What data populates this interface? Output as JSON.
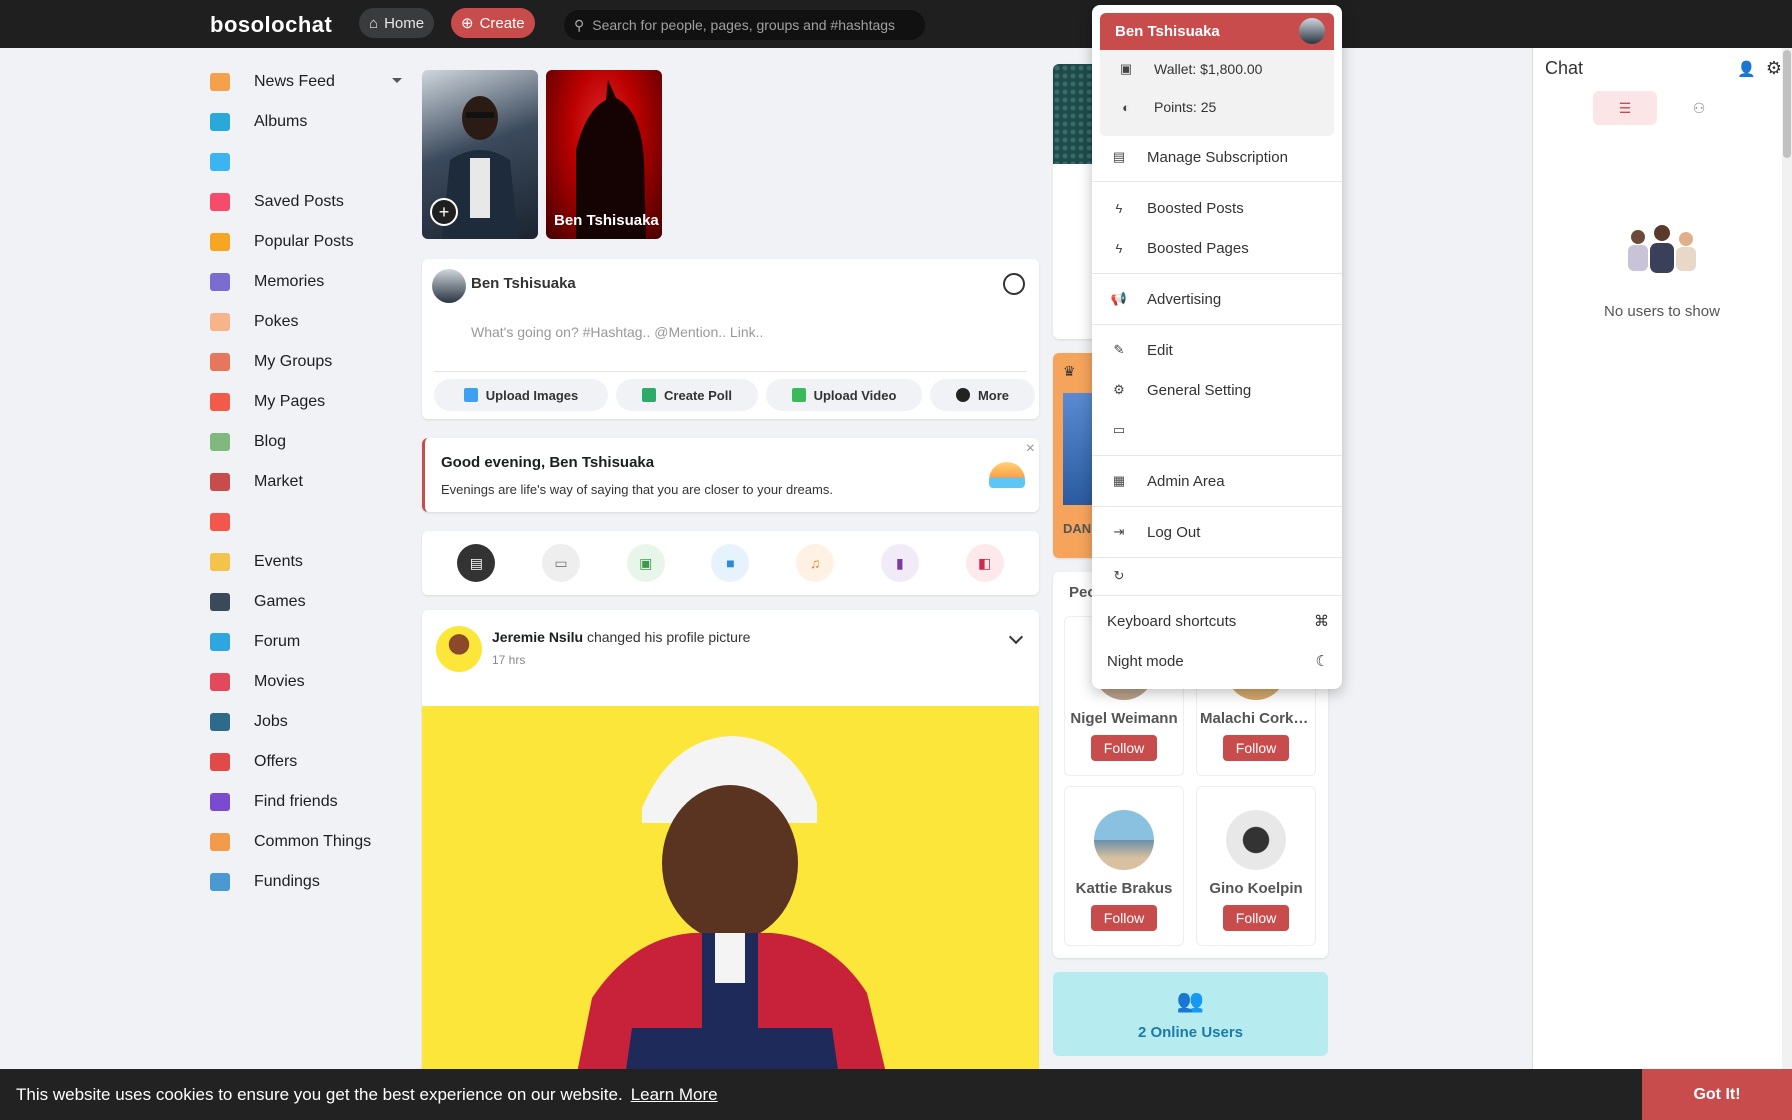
{
  "topbar": {
    "logo": "bosolochat",
    "home_label": "Home",
    "create_label": "Create",
    "search_placeholder": "Search for people, pages, groups and #hashtags"
  },
  "sidebar": {
    "items": [
      {
        "label": "News Feed",
        "color": "#f3a24b"
      },
      {
        "label": "Albums",
        "color": "#29a9d8"
      },
      {
        "label": "",
        "color": "#3db4f2"
      },
      {
        "label": "Saved Posts",
        "color": "#f44c6a"
      },
      {
        "label": "Popular Posts",
        "color": "#f6a623"
      },
      {
        "label": "Memories",
        "color": "#7a6cd1"
      },
      {
        "label": "Pokes",
        "color": "#f7b48b"
      },
      {
        "label": "My Groups",
        "color": "#e6775c"
      },
      {
        "label": "My Pages",
        "color": "#f25b4a"
      },
      {
        "label": "Blog",
        "color": "#7fb97d"
      },
      {
        "label": "Market",
        "color": "#c94c4c"
      },
      {
        "label": "",
        "color": "#f2574c"
      },
      {
        "label": "Events",
        "color": "#f3c34b"
      },
      {
        "label": "Games",
        "color": "#3a4a5a"
      },
      {
        "label": "Forum",
        "color": "#2fa6df"
      },
      {
        "label": "Movies",
        "color": "#e24a5c"
      },
      {
        "label": "Jobs",
        "color": "#2e6b8a"
      },
      {
        "label": "Offers",
        "color": "#e24a4a"
      },
      {
        "label": "Find friends",
        "color": "#7a4ad1"
      },
      {
        "label": "Common Things",
        "color": "#f29b4a"
      },
      {
        "label": "Fundings",
        "color": "#4a9ad1"
      }
    ]
  },
  "stories": {
    "story2_name": "Ben Tshisuaka"
  },
  "composer": {
    "user_name": "Ben Tshisuaka",
    "placeholder": "What's going on? #Hashtag.. @Mention.. Link..",
    "buttons": [
      "Upload Images",
      "Create Poll",
      "Upload Video",
      "More"
    ]
  },
  "greeting": {
    "title": "Good evening, Ben Tshisuaka",
    "subtitle": "Evenings are life's way of saying that you are closer to your dreams.",
    "close": "×"
  },
  "post": {
    "author": "Jeremie Nsilu",
    "action": "changed his profile picture",
    "time": "17 hrs"
  },
  "people": {
    "header": "Peo",
    "row0": [
      "Nigel Weimann",
      "Malachi Corkery"
    ],
    "row1": [
      "Kattie Brakus",
      "Gino Koelpin"
    ],
    "follow_label": "Follow"
  },
  "pro_label": "DAN",
  "online": {
    "label": "2 Online Users"
  },
  "chat": {
    "title": "Chat",
    "empty_text": "No users to show"
  },
  "user_menu": {
    "name": "Ben Tshisuaka",
    "wallet": "Wallet: $1,800.00",
    "points": "Points: 25",
    "items": {
      "manage_subscription": "Manage Subscription",
      "boosted_posts": "Boosted Posts",
      "boosted_pages": "Boosted Pages",
      "advertising": "Advertising",
      "edit": "Edit",
      "general_setting": "General Setting",
      "admin_area": "Admin Area",
      "log_out": "Log Out",
      "keyboard_shortcuts": "Keyboard shortcuts",
      "night_mode": "Night mode"
    }
  },
  "cookie": {
    "text": "This website uses cookies to ensure you get the best experience on our website.",
    "learn_more": "Learn More",
    "got_it": "Got It!"
  }
}
